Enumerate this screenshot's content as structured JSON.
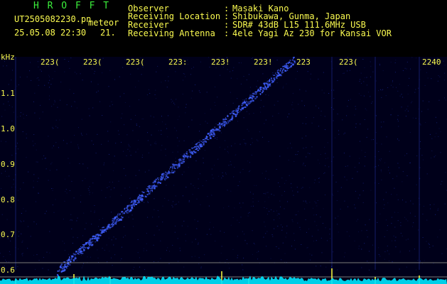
{
  "header": {
    "app_title": "H R O F F T",
    "filename": "UT2505082230.pn",
    "mode": "meteor",
    "datetime": "25.05.08 22:30",
    "frame_number": "21.",
    "fields": [
      {
        "label": "Observer",
        "sep": ":",
        "value": "Masaki Kano"
      },
      {
        "label": "Receiving Location",
        "sep": ":",
        "value": "Shibukawa, Gunma, Japan"
      },
      {
        "label": "Receiver",
        "sep": ":",
        "value": "SDR# 43dB L15 111.6MHz USB"
      },
      {
        "label": "Receiving Antenna",
        "sep": ":",
        "value": "4ele Yagi Az 230 for Kansai VOR"
      }
    ]
  },
  "spectrogram": {
    "y_unit": "kHz",
    "y_ticks": [
      "1.1",
      "1.0",
      "0.9",
      "0.8",
      "0.7",
      "0.6"
    ],
    "x_ticks": [
      "223(",
      "223(",
      "223(",
      "223:",
      "223!",
      "223!",
      "223",
      "223(",
      "2240"
    ],
    "colors": {
      "background": "#00001a",
      "trace": "#4060ff",
      "baseline": "#00e5ff",
      "spike": "#ffff40",
      "labels": "#fbfb50",
      "guide_lines": "#b0b0a0"
    }
  }
}
